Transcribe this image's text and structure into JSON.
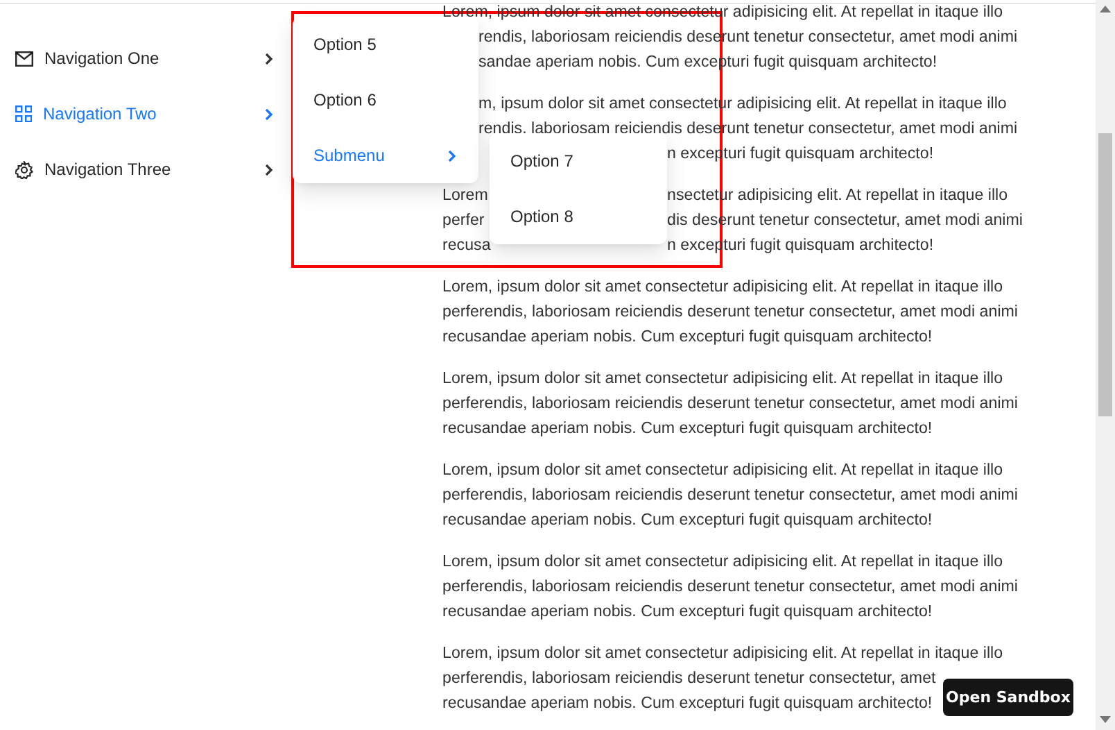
{
  "sidebar": {
    "items": [
      {
        "label": "Navigation One",
        "selected": false
      },
      {
        "label": "Navigation Two",
        "selected": true
      },
      {
        "label": "Navigation Three",
        "selected": false
      }
    ]
  },
  "popup_menu": {
    "items": [
      {
        "kind": "option",
        "label": "Option 5",
        "selected": false
      },
      {
        "kind": "option",
        "label": "Option 6",
        "selected": false
      },
      {
        "kind": "submenu",
        "label": "Submenu",
        "selected": true
      }
    ]
  },
  "submenu": {
    "items": [
      {
        "label": "Option 7",
        "selected": false
      },
      {
        "label": "Option 8",
        "selected": false
      }
    ]
  },
  "content": {
    "paragraphs": [
      {
        "kind": "partial",
        "lines": [
          [
            {
              "kind": "start",
              "text": "Lorem, ipsum dolor sit amet consectetur adipisicing elit. At repellat in itaque illo"
            }
          ],
          [
            {
              "kind": "after_menu",
              "text": "rendis, laboriosam reiciendis deserunt tenetur consectetur, amet modi animi"
            }
          ],
          [
            {
              "kind": "after_menu",
              "text": "sandae aperiam nobis. Cum excepturi fugit quisquam architecto!"
            }
          ]
        ]
      },
      {
        "kind": "partial",
        "lines": [
          [
            {
              "kind": "after_menu",
              "text": "m, ipsum dolor sit amet consectetur adipisicing elit. At repellat in itaque illo"
            }
          ],
          [
            {
              "kind": "after_menu",
              "text": "rendis, laboriosam reiciendis deserunt tenetur consectetur, amet modi animi"
            }
          ],
          [
            {
              "kind": "after_submenu",
              "text": "n excepturi fugit quisquam architecto!"
            }
          ]
        ]
      },
      {
        "kind": "partial",
        "lines": [
          [
            {
              "kind": "start",
              "text": "Lorem"
            },
            {
              "kind": "after_submenu",
              "text": "nsectetur adipisicing elit. At repellat in itaque illo"
            }
          ],
          [
            {
              "kind": "start",
              "text": "perfer"
            },
            {
              "kind": "after_submenu",
              "text": "dis deserunt tenetur consectetur, amet modi animi"
            }
          ],
          [
            {
              "kind": "start",
              "text": "recusa"
            },
            {
              "kind": "after_submenu",
              "text": "n excepturi fugit quisquam architecto!"
            }
          ]
        ]
      },
      {
        "kind": "full",
        "text": "Lorem, ipsum dolor sit amet consectetur adipisicing elit. At repellat in itaque illo perferendis, laboriosam reiciendis deserunt tenetur consectetur, amet modi animi recusandae aperiam nobis. Cum excepturi fugit quisquam architecto!"
      },
      {
        "kind": "full",
        "text": "Lorem, ipsum dolor sit amet consectetur adipisicing elit. At repellat in itaque illo perferendis, laboriosam reiciendis deserunt tenetur consectetur, amet modi animi recusandae aperiam nobis. Cum excepturi fugit quisquam architecto!"
      },
      {
        "kind": "full",
        "text": "Lorem, ipsum dolor sit amet consectetur adipisicing elit. At repellat in itaque illo perferendis, laboriosam reiciendis deserunt tenetur consectetur, amet modi animi recusandae aperiam nobis. Cum excepturi fugit quisquam architecto!"
      },
      {
        "kind": "full",
        "text": "Lorem, ipsum dolor sit amet consectetur adipisicing elit. At repellat in itaque illo perferendis, laboriosam reiciendis deserunt tenetur consectetur, amet modi animi recusandae aperiam nobis. Cum excepturi fugit quisquam architecto!"
      },
      {
        "kind": "partial",
        "lines": [
          [
            {
              "kind": "start",
              "text": "Lorem, ipsum dolor sit amet consectetur adipisicing elit. At repellat in itaque illo"
            }
          ],
          [
            {
              "kind": "start",
              "text": "perferendis, laboriosam reiciendis deserunt tenetur consectetur, amet"
            }
          ],
          [
            {
              "kind": "start",
              "text": "recusandae aperiam nobis. Cum excepturi fugit quisquam architecto!"
            }
          ]
        ]
      }
    ]
  },
  "sandbox_button": {
    "label": "Open Sandbox"
  }
}
